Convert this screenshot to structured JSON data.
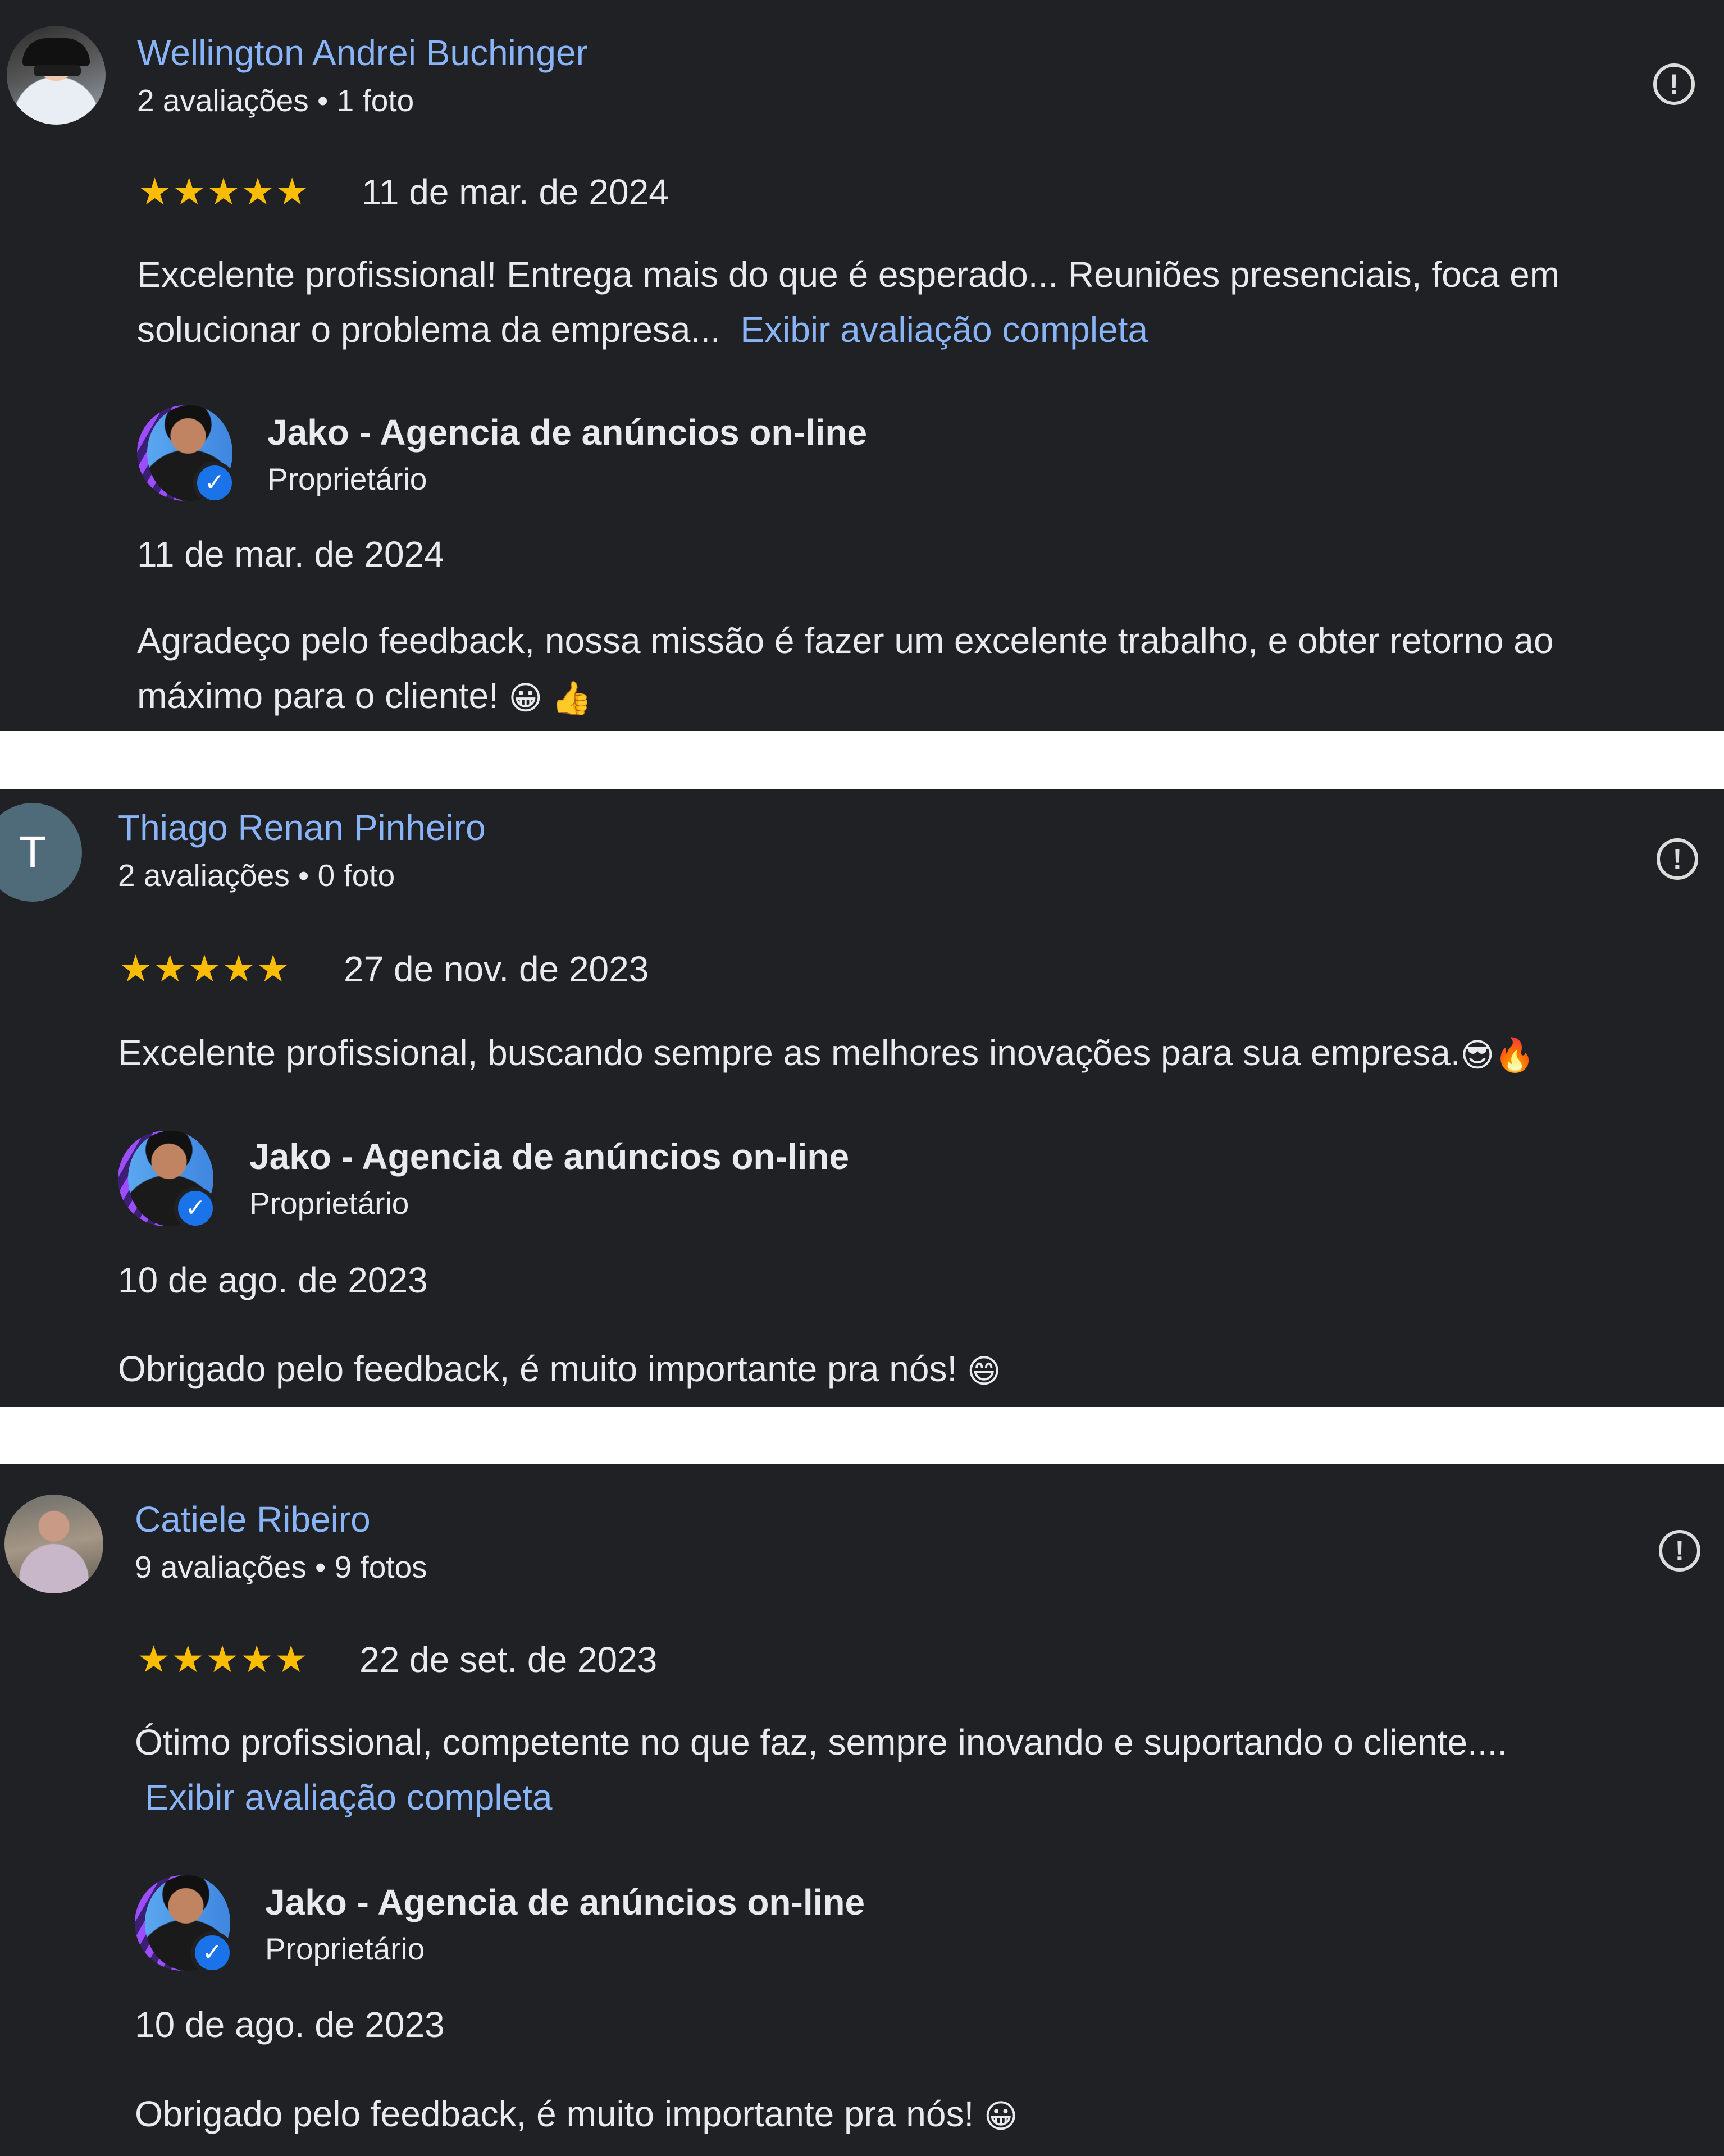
{
  "reviews": [
    {
      "reviewer": "Wellington Andrei Buchinger",
      "meta": "2 avaliações • 1 foto",
      "stars": "★★★★★",
      "date": "11 de mar. de 2024",
      "text_line1": "Excelente profissional! Entrega mais do que é esperado... Reuniões presenciais, foca em",
      "text_line2": "solucionar o problema da empresa...",
      "more_link": "Exibir avaliação completa",
      "owner_name": "Jako - Agencia de anúncios on-line",
      "owner_role": "Proprietário",
      "reply_date": "11 de mar. de 2024",
      "reply_line1": "Agradeço pelo feedback, nossa missão é fazer um excelente trabalho, e obter retorno ao",
      "reply_line2": "máximo para o cliente!",
      "reply_emoji": "😀 👍"
    },
    {
      "reviewer": "Thiago Renan Pinheiro",
      "avatar_letter": "T",
      "meta": "2 avaliações • 0 foto",
      "stars": "★★★★★",
      "date": "27 de nov. de 2023",
      "text_line1": "Excelente profissional, buscando sempre as melhores inovações para sua empresa.",
      "text_emoji": "😎🔥",
      "owner_name": "Jako - Agencia de anúncios on-line",
      "owner_role": "Proprietário",
      "reply_date": "10 de ago. de 2023",
      "reply_line1": "Obrigado pelo feedback, é muito importante pra nós!",
      "reply_emoji": "😄"
    },
    {
      "reviewer": "Catiele Ribeiro",
      "meta": "9 avaliações • 9 fotos",
      "stars": "★★★★★",
      "date": "22 de set. de 2023",
      "text_line1": "Ótimo profissional, competente no que faz, sempre inovando e suportando o cliente....",
      "more_link": "Exibir avaliação completa",
      "owner_name": "Jako - Agencia de anúncios on-line",
      "owner_role": "Proprietário",
      "reply_date": "10 de ago. de 2023",
      "reply_line1": "Obrigado pelo feedback, é muito importante pra nós!",
      "reply_emoji": "😀"
    }
  ],
  "flag_glyph": "!",
  "verified_glyph": "✓",
  "colors": {
    "background": "#202124",
    "name_link": "#8ab4f8",
    "star": "#fbbc04",
    "text": "#e8eaed",
    "verified_badge": "#1a73e8"
  }
}
